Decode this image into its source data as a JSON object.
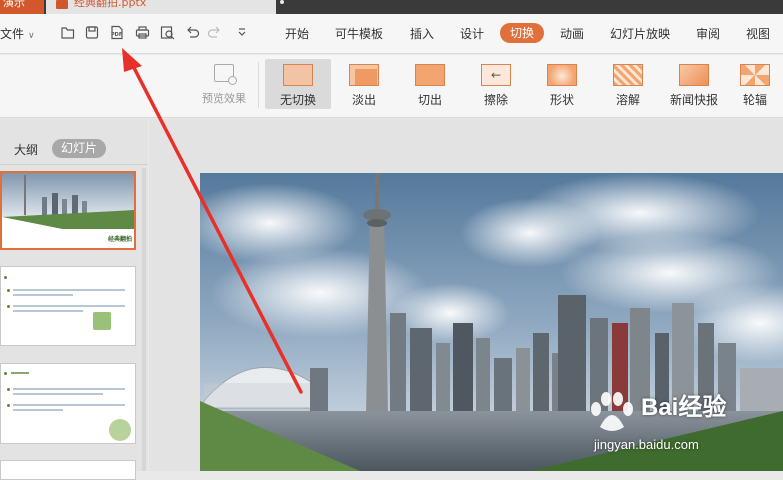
{
  "titlebar": {
    "app_tab": "演示",
    "file_tab": "经典翻拍.pptx"
  },
  "menubar": {
    "file_label": "文件",
    "toolbar_icons": [
      "open-folder-icon",
      "save-icon",
      "export-pdf-icon",
      "print-icon",
      "print-preview-icon",
      "undo-icon",
      "redo-icon",
      "more-dropdown-icon"
    ],
    "pdf_badge": "PDF",
    "items": [
      "开始",
      "可牛模板",
      "插入",
      "设计",
      "切换",
      "动画",
      "幻灯片放映",
      "审阅",
      "视图"
    ],
    "active_item": "切换"
  },
  "ribbon": {
    "preview_label": "预览效果",
    "effects": [
      {
        "label": "无切换",
        "icon": "no-transition-icon"
      },
      {
        "label": "淡出",
        "icon": "fade-icon"
      },
      {
        "label": "切出",
        "icon": "cut-icon"
      },
      {
        "label": "擦除",
        "icon": "wipe-icon"
      },
      {
        "label": "形状",
        "icon": "shape-icon"
      },
      {
        "label": "溶解",
        "icon": "dissolve-icon"
      },
      {
        "label": "新闻快报",
        "icon": "newsflash-icon"
      },
      {
        "label": "轮辐",
        "icon": "wheel-icon"
      }
    ],
    "selected_effect": "无切换"
  },
  "left_panel": {
    "tabs": [
      "大纲",
      "幻灯片"
    ],
    "active_tab": "幻灯片",
    "thumb1_caption": "经典翻拍"
  },
  "watermark": {
    "brand": "Bai经验",
    "url": "jingyan.baidu.com"
  },
  "colors": {
    "accent": "#e0703b",
    "slide_green": "#5f8a45",
    "dark_green": "#3f6b2e",
    "annotation_arrow": "#e8302a"
  }
}
